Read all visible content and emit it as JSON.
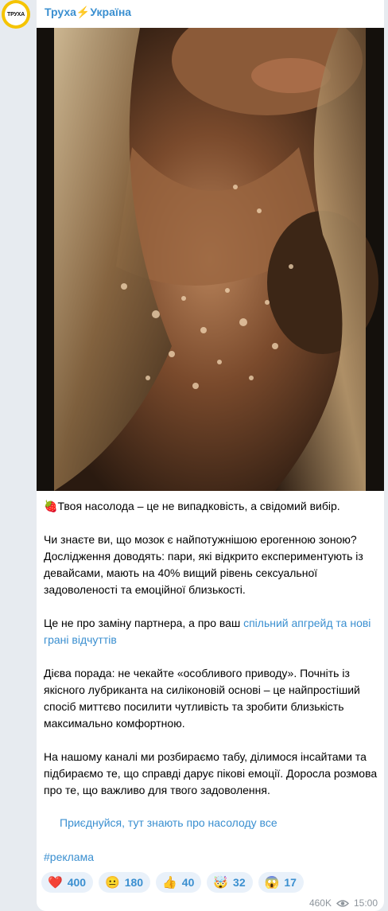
{
  "channel": {
    "avatar_text": "ТРУХА",
    "name_part1": "Труха",
    "bolt": "⚡",
    "name_part2": "Україна"
  },
  "post": {
    "line1_emoji": "🍓",
    "line1": "Твоя насолода – це не випадковість, а свідомий вибір.",
    "para2": "Чи знаєте ви, що мозок є найпотужнішою ерогенною зоною? Дослідження доводять: пари, які відкрито експериментують із девайсами, мають на 40% вищий рівень сексуальної задоволеності та емоційної близькості.",
    "para3_text": "Це не про заміну партнера, а про ваш ",
    "para3_link": "спільний апгрейд та нові грані відчуттів",
    "para4": "Дієва порада: не чекайте «особливого приводу». Почніть із якісного лубриканта на силіконовій основі – це найпростіший спосіб миттєво посилити чутливість та зробити близькість максимально комфортною.",
    "para5": "На нашому каналі ми розбираємо табу, ділимося інсайтами та підбираємо те, що справді дарує пікові емоції. Доросла розмова про те, що важливо для твого задоволення.",
    "cta_link": "Приєднуйся, тут знають про насолоду все",
    "hashtag": "#реклама"
  },
  "reactions": [
    {
      "emoji": "❤️",
      "count": "400"
    },
    {
      "emoji": "😐",
      "count": "180"
    },
    {
      "emoji": "👍",
      "count": "40"
    },
    {
      "emoji": "🤯",
      "count": "32"
    },
    {
      "emoji": "😱",
      "count": "17"
    }
  ],
  "meta": {
    "views": "460K",
    "time": "15:00"
  },
  "colors": {
    "accent": "#3a8fd0",
    "background": "#e7ebf0",
    "reaction_bg": "#e9f1fa"
  }
}
